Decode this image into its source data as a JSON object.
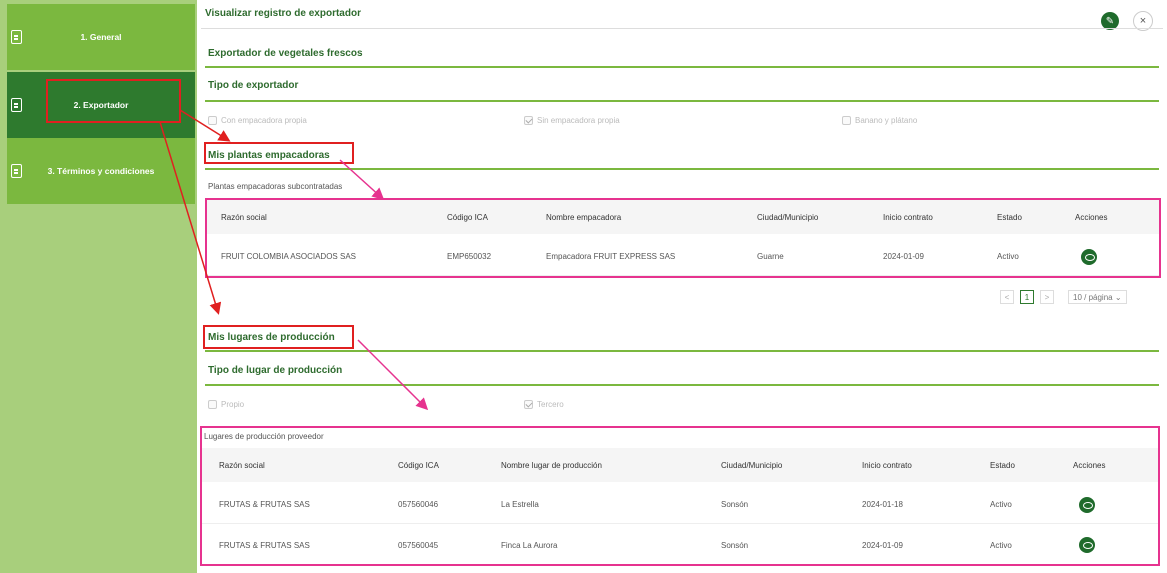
{
  "sidebar": {
    "items": [
      {
        "label": "1. General"
      },
      {
        "label": "2. Exportador"
      },
      {
        "label": "3. Términos y condiciones"
      }
    ]
  },
  "header": {
    "title": "Visualizar registro de exportador",
    "edit_icon": "pencil-icon",
    "close_label": "×"
  },
  "sections": {
    "exporter_type_title": "Exportador de vegetales frescos",
    "tipo_exportador": "Tipo de exportador",
    "tipo_options": [
      {
        "label": "Con empacadora propia",
        "checked": false
      },
      {
        "label": "Sin empacadora propia",
        "checked": true
      },
      {
        "label": "Banano y plátano",
        "checked": false
      }
    ],
    "plantas_title": "Mis plantas empacadoras",
    "plantas_sub": "Plantas empacadoras subcontratadas",
    "lugares_title": "Mis lugares de producción",
    "tipo_lugar": "Tipo de lugar de producción",
    "lugar_options": [
      {
        "label": "Propio",
        "checked": false
      },
      {
        "label": "Tercero",
        "checked": true
      }
    ],
    "lugares_sub": "Lugares de producción proveedor"
  },
  "plantas_table": {
    "columns": [
      "Razón social",
      "Código ICA",
      "Nombre empacadora",
      "Ciudad/Municipio",
      "Inicio contrato",
      "Estado",
      "Acciones"
    ],
    "rows": [
      [
        "FRUIT COLOMBIA ASOCIADOS SAS",
        "EMP650032",
        "Empacadora FRUIT EXPRESS SAS",
        "Guarne",
        "2024-01-09",
        "Activo"
      ]
    ]
  },
  "pager": {
    "page": "1",
    "per_page": "10 / página",
    "prev": "<",
    "next": ">"
  },
  "lugares_table": {
    "columns": [
      "Razón social",
      "Código ICA",
      "Nombre lugar de producción",
      "Ciudad/Municipio",
      "Inicio contrato",
      "Estado",
      "Acciones"
    ],
    "rows": [
      [
        "FRUTAS & FRUTAS SAS",
        "057560046",
        "La Estrella",
        "Sonsón",
        "2024-01-18",
        "Activo"
      ],
      [
        "FRUTAS & FRUTAS SAS",
        "057560045",
        "Finca La Aurora",
        "Sonsón",
        "2024-01-09",
        "Activo"
      ]
    ]
  },
  "colors": {
    "accent": "#2e7a2e",
    "sidebar": "#a8cf7c",
    "annotation_red": "#e02020",
    "annotation_pink": "#e6338f"
  }
}
